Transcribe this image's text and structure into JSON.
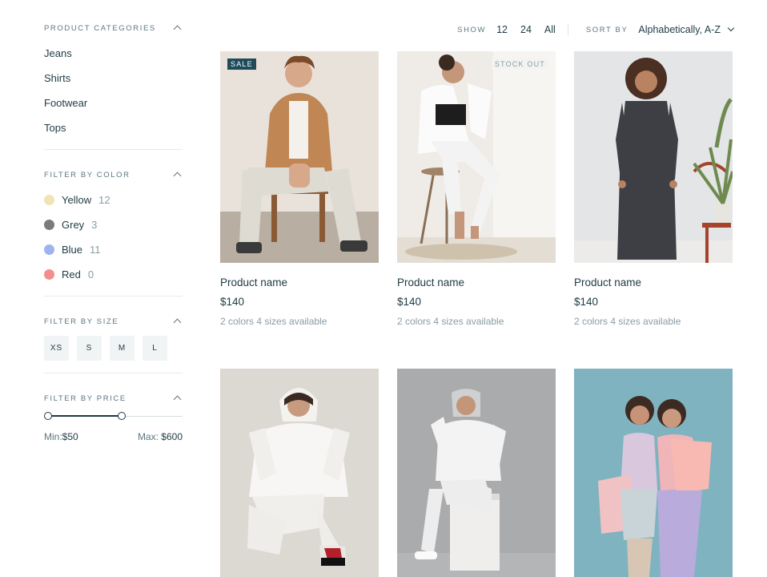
{
  "sidebar": {
    "categories": {
      "title": "PRODUCT CATEGORIES",
      "items": [
        "Jeans",
        "Shirts",
        "Footwear",
        "Tops"
      ]
    },
    "colors": {
      "title": "FILTER BY COLOR",
      "items": [
        {
          "label": "Yellow",
          "count": "12",
          "color": "#f0e3b5"
        },
        {
          "label": "Grey",
          "count": "3",
          "color": "#7b7b7b"
        },
        {
          "label": "Blue",
          "count": "11",
          "color": "#9fb3ee"
        },
        {
          "label": "Red",
          "count": "0",
          "color": "#f28f8c"
        }
      ]
    },
    "sizes": {
      "title": "FILTER BY SIZE",
      "items": [
        "XS",
        "S",
        "M",
        "L"
      ]
    },
    "price": {
      "title": "FILTER BY PRICE",
      "min_label": "Min:",
      "min_value": "$50",
      "max_label": "Max:",
      "max_value": "$600"
    }
  },
  "toolbar": {
    "show_label": "SHOW",
    "show_options": [
      "12",
      "24",
      "All"
    ],
    "sort_label": "SORT BY",
    "sort_value": "Alphabetically, A-Z"
  },
  "products": [
    {
      "name": "Product name",
      "price": "$140",
      "meta": "2 colors 4 sizes available",
      "badge": "SALE"
    },
    {
      "name": "Product name",
      "price": "$140",
      "meta": "2 colors 4 sizes available",
      "badge": "STOCK OUT"
    },
    {
      "name": "Product name",
      "price": "$140",
      "meta": "2 colors 4 sizes available",
      "badge": ""
    },
    {
      "name": "",
      "price": "",
      "meta": "",
      "badge": ""
    },
    {
      "name": "",
      "price": "",
      "meta": "",
      "badge": ""
    },
    {
      "name": "",
      "price": "",
      "meta": "",
      "badge": ""
    }
  ],
  "icons": {
    "collapse": "chevron-up-icon",
    "sort_dropdown": "chevron-down-icon"
  }
}
